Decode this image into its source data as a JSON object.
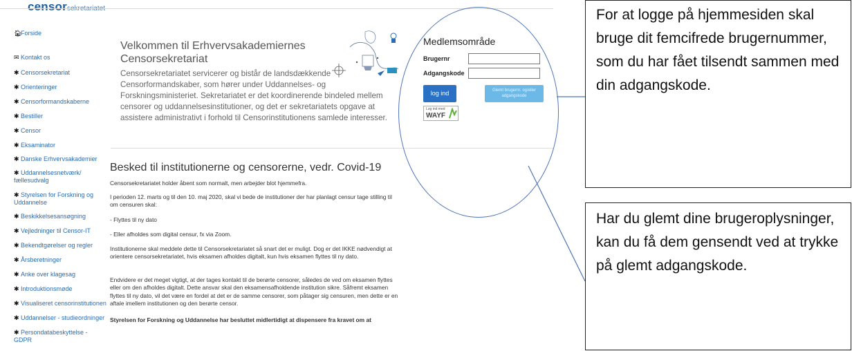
{
  "logo": {
    "main": "censor",
    "sub": "sekretariatet"
  },
  "sidebar": {
    "items": [
      {
        "icon": "home-icon",
        "label": "Forside"
      },
      {
        "icon": "envelope-icon",
        "label": "Kontakt os"
      },
      {
        "icon": "asterisk-icon",
        "label": "Censorsekretariat"
      },
      {
        "icon": "asterisk-icon",
        "label": "Orienteringer"
      },
      {
        "icon": "asterisk-icon",
        "label": "Censorformandskaberne"
      },
      {
        "icon": "asterisk-icon",
        "label": "Bestiller"
      },
      {
        "icon": "asterisk-icon",
        "label": "Censor"
      },
      {
        "icon": "asterisk-icon",
        "label": "Eksaminator"
      },
      {
        "icon": "asterisk-icon",
        "label": "Danske Erhvervsakademier"
      },
      {
        "icon": "asterisk-icon",
        "label": "Uddannelsesnetværk/ fællesudvalg"
      },
      {
        "icon": "asterisk-icon",
        "label": "Styrelsen for Forskning og Uddannelse"
      },
      {
        "icon": "asterisk-icon",
        "label": "Beskikkelsesansøgning"
      },
      {
        "icon": "asterisk-icon",
        "label": "Vejledninger til Censor-IT"
      },
      {
        "icon": "asterisk-icon",
        "label": "Bekendtgørelser og regler"
      },
      {
        "icon": "asterisk-icon",
        "label": "Årsberetninger"
      },
      {
        "icon": "asterisk-icon",
        "label": "Anke over klagesag"
      },
      {
        "icon": "asterisk-icon",
        "label": "Introduktionsmøde"
      },
      {
        "icon": "asterisk-icon",
        "label": "Visualiseret censorinstitutionen"
      },
      {
        "icon": "asterisk-icon",
        "label": "Uddannelser - studieordninger"
      },
      {
        "icon": "asterisk-icon",
        "label": "Persondatabeskyttelse - GDPR"
      }
    ]
  },
  "welcome": {
    "title": "Velkommen til Erhvervsakademiernes Censorsekretariat",
    "text": "Censorsekretariatet servicerer og bistår de landsdækkende Censorformandskaber, som hører under Uddannelses- og Forskningsministeriet. Sekretariatet er det koordinerende bindeled mellem censorer og uddannelsesinstitutioner, og det er sekretariatets opgave at assistere administrativt i forhold til Censorinstitutionens samlede interesser."
  },
  "covid": {
    "title": "Besked til institutionerne og censorerne, vedr. Covid-19",
    "paragraphs": [
      "Censorsekretariatet holder åbent som normalt, men arbejder blot hjemmefra.",
      "I perioden 12. marts og til den 10. maj 2020, skal vi bede de institutioner der har planlagt censur tage stilling til om censuren skal:",
      "- Flyttes til ny dato",
      "- Eller afholdes som digital censur, fx via Zoom.",
      "Institutionerne skal meddele dette til Censorsekretariatet så snart det er muligt. Dog er det IKKE nødvendigt at orientere censorsekretariatet, hvis eksamen afholdes digitalt, kun hvis eksamen flyttes til ny dato.",
      "Endvidere er det meget vigtigt, at der tages kontakt til de berørte censorer, således de ved om eksamen flyttes eller om den afholdes digitalt. Dette ansvar skal den eksamensafholdende institution sikre. Såfremt eksamen flyttes til ny dato, vil det være en fordel at det er de samme censorer, som påtager sig censuren, men dette er en aftale imellem institutionen og den berørte censor.",
      "Styrelsen for Forskning og Uddannelse har besluttet midlertidigt at dispensere fra kravet om at"
    ]
  },
  "member": {
    "title": "Medlemsområde",
    "user_label": "Brugernr",
    "pass_label": "Adgangskode",
    "user_value": "",
    "pass_value": "",
    "login_label": "log ind",
    "forgot_label": "Glemt brugernr. og/eller adgangskode",
    "wayf_small": "Log ind med",
    "wayf_big": "WAYF"
  },
  "callouts": {
    "login_help": "For at logge på hjemmesiden skal bruge dit femcifrede brugernummer, som du har fået tilsendt sammen med din adgangskode.",
    "forgot_help": "Har du glemt dine brugeroplysninger, kan du få dem gensendt ved at trykke på glemt adgangskode."
  },
  "colors": {
    "link": "#2a6cb0",
    "brand": "#1f5f9e",
    "login_button": "#2a70c4",
    "forgot_button": "#6cb8e6",
    "annotation": "#4e74b8"
  }
}
